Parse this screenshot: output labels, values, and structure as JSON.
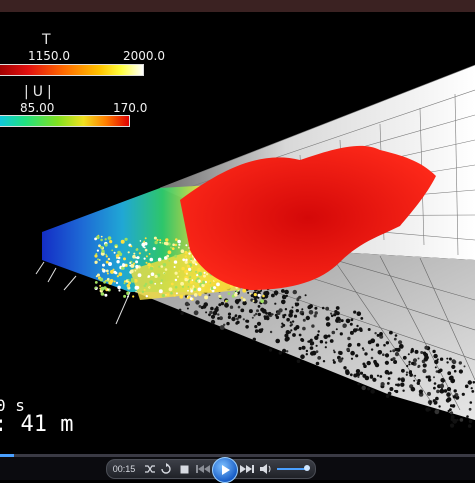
{
  "legend_temperature": {
    "title": "T",
    "min": "1150.0",
    "max": "2000.0"
  },
  "legend_velocity": {
    "title": "|U|",
    "min": "85.00",
    "max": "170.0"
  },
  "overlay": {
    "time_fragment": "0 s",
    "distance": ": 41 m"
  },
  "player": {
    "elapsed": "00:15",
    "seek_progress": 0.03,
    "volume_level": 0.9,
    "icons": [
      "shuffle-icon",
      "repeat-icon",
      "stop-icon",
      "previous-icon",
      "play-icon",
      "next-icon",
      "volume-icon"
    ]
  },
  "colors": {
    "accent": "#4aa0ff",
    "fireball_red": "#e01414",
    "wall_gray": "#c8c8c8"
  }
}
